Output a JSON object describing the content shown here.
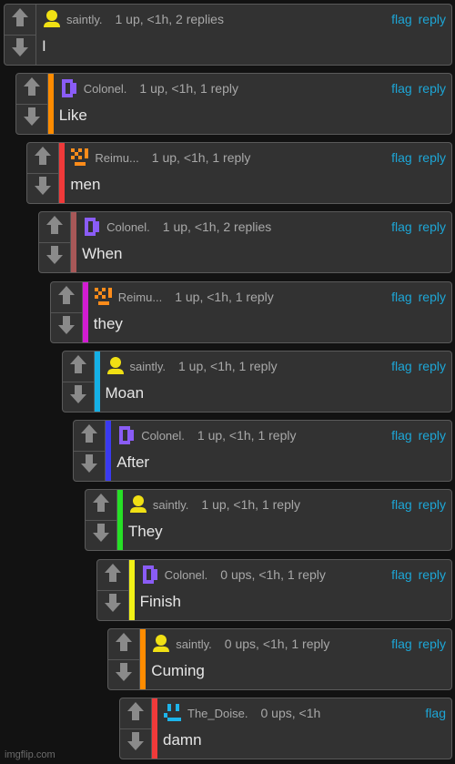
{
  "comments": [
    {
      "user": "saintly.",
      "avatar": "yellow-person-icon",
      "meta": "1 up, <1h, 2 replies",
      "text": "I",
      "bar_color": "",
      "actions": [
        "flag",
        "reply"
      ]
    },
    {
      "user": "Colonel.",
      "avatar": "purple-bracket-icon",
      "meta": "1 up, <1h, 1 reply",
      "text": "Like",
      "bar_color": "#ff8c00",
      "actions": [
        "flag",
        "reply"
      ]
    },
    {
      "user": "Reimu...",
      "avatar": "orange-pixel-face-icon",
      "meta": "1 up, <1h, 1 reply",
      "text": "men",
      "bar_color": "#f03a3a",
      "actions": [
        "flag",
        "reply"
      ]
    },
    {
      "user": "Colonel.",
      "avatar": "purple-bracket-icon",
      "meta": "1 up, <1h, 2 replies",
      "text": "When",
      "bar_color": "#a85858",
      "actions": [
        "flag",
        "reply"
      ]
    },
    {
      "user": "Reimu...",
      "avatar": "orange-pixel-face-icon",
      "meta": "1 up, <1h, 1 reply",
      "text": "they",
      "bar_color": "#d31cd3",
      "actions": [
        "flag",
        "reply"
      ]
    },
    {
      "user": "saintly.",
      "avatar": "yellow-person-icon",
      "meta": "1 up, <1h, 1 reply",
      "text": "Moan",
      "bar_color": "#14b0e6",
      "actions": [
        "flag",
        "reply"
      ]
    },
    {
      "user": "Colonel.",
      "avatar": "purple-bracket-icon",
      "meta": "1 up, <1h, 1 reply",
      "text": "After",
      "bar_color": "#3a3af0",
      "actions": [
        "flag",
        "reply"
      ]
    },
    {
      "user": "saintly.",
      "avatar": "yellow-person-icon",
      "meta": "1 up, <1h, 1 reply",
      "text": "They",
      "bar_color": "#26e026",
      "actions": [
        "flag",
        "reply"
      ]
    },
    {
      "user": "Colonel.",
      "avatar": "purple-bracket-icon",
      "meta": "0 ups, <1h, 1 reply",
      "text": "Finish",
      "bar_color": "#f2f216",
      "actions": [
        "flag",
        "reply"
      ]
    },
    {
      "user": "saintly.",
      "avatar": "yellow-person-icon",
      "meta": "0 ups, <1h, 1 reply",
      "text": "Cuming",
      "bar_color": "#ff8c00",
      "actions": [
        "flag",
        "reply"
      ]
    },
    {
      "user": "The_Doise.",
      "avatar": "blue-pixel-face-icon",
      "meta": "0 ups, <1h",
      "text": "damn",
      "bar_color": "#f03a3a",
      "actions": [
        "flag"
      ]
    }
  ],
  "colors": {
    "link": "#1da6d6",
    "background": "#121212",
    "card": "#323232"
  },
  "watermark": "imgflip.com"
}
